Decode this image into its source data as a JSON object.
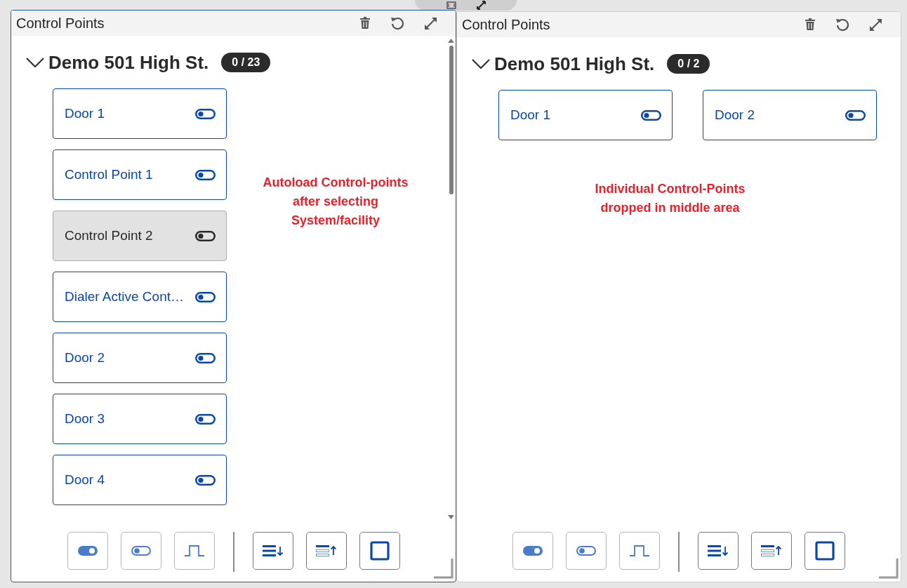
{
  "panels": [
    {
      "title": "Control Points",
      "selected": true,
      "kind": "column",
      "scrollable": true,
      "group": {
        "title": "Demo 501 High St.",
        "count": "0 / 23",
        "expanded": true
      },
      "items": [
        {
          "label": "Door 1",
          "disabled": false
        },
        {
          "label": "Control Point 1",
          "disabled": false
        },
        {
          "label": "Control Point 2",
          "disabled": true
        },
        {
          "label": "Dialer Active Cont…",
          "disabled": false
        },
        {
          "label": "Door 2",
          "disabled": false
        },
        {
          "label": "Door 3",
          "disabled": false
        },
        {
          "label": "Door 4",
          "disabled": false
        }
      ],
      "note": "Autoload Control-points\nafter selecting\nSystem/facility"
    },
    {
      "title": "Control Points",
      "selected": false,
      "kind": "row",
      "scrollable": false,
      "group": {
        "title": "Demo 501 High St.",
        "count": "0 / 2",
        "expanded": true
      },
      "items": [
        {
          "label": "Door 1",
          "disabled": false
        },
        {
          "label": "Door 2",
          "disabled": false
        }
      ],
      "note": "Individual Control-Points\ndropped in middle area"
    }
  ]
}
